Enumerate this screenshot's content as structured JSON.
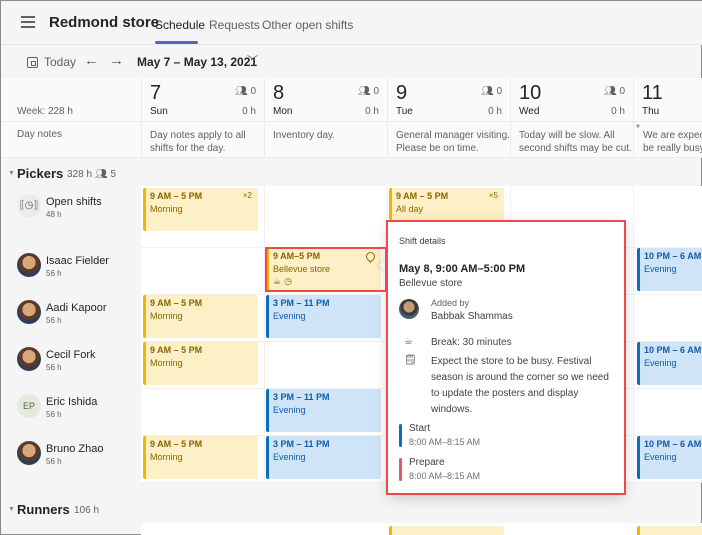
{
  "header": {
    "store_title": "Redmond store",
    "tabs": [
      {
        "label": "Schedule",
        "active": true
      },
      {
        "label": "Requests",
        "active": false
      },
      {
        "label": "Other open shifts",
        "active": false
      }
    ],
    "accent_color": "#5b5fc7"
  },
  "toolbar": {
    "today_label": "Today",
    "prev_icon": "arrow-left-icon",
    "next_icon": "arrow-right-icon",
    "date_range": "May 7 – May 13, 2021"
  },
  "grid": {
    "week_label": "Week: 228 h",
    "day_notes_label": "Day notes",
    "days": [
      {
        "num": "7",
        "name": "Sun",
        "people": "0",
        "hours": "0 h",
        "note1": "Day notes apply to all",
        "note2": "shifts for the day."
      },
      {
        "num": "8",
        "name": "Mon",
        "people": "0",
        "hours": "0 h",
        "note1": "Inventory day.",
        "note2": ""
      },
      {
        "num": "9",
        "name": "Tue",
        "people": "0",
        "hours": "0 h",
        "note1": "General manager visiting.",
        "note2": "Please be on time."
      },
      {
        "num": "10",
        "name": "Wed",
        "people": "0",
        "hours": "0 h",
        "note1": "Today will be slow. All",
        "note2": "second shifts may be cut."
      },
      {
        "num": "11",
        "name": "Thu",
        "people": "",
        "hours": "",
        "note1": "We are expecting",
        "note2": "be really busy."
      }
    ]
  },
  "groups": [
    {
      "name": "Pickers",
      "hours": "328 h",
      "members": "5"
    },
    {
      "name": "Runners",
      "hours": "106 h"
    }
  ],
  "members": [
    {
      "name": "Open shifts",
      "hours": "48 h",
      "avatar": "open-shifts-icon"
    },
    {
      "name": "Isaac Fielder",
      "hours": "56 h",
      "avatar": "photo"
    },
    {
      "name": "Aadi Kapoor",
      "hours": "56 h",
      "avatar": "photo"
    },
    {
      "name": "Cecil Fork",
      "hours": "56 h",
      "avatar": "photo"
    },
    {
      "name": "Eric Ishida",
      "hours": "56 h",
      "avatar": "EP"
    },
    {
      "name": "Bruno Zhao",
      "hours": "56 h",
      "avatar": "photo"
    }
  ],
  "shifts": {
    "open_sun": {
      "time": "9 AM – 5 PM",
      "label": "Morning",
      "count": "×2"
    },
    "open_tue": {
      "time": "9 AM – 5 PM",
      "label": "All day",
      "count": "×5"
    },
    "isaac_mon": {
      "time": "9 AM–5 PM",
      "label": "Bellevue store"
    },
    "isaac_thu": {
      "time": "10 PM – 6 AM",
      "label": "Evening"
    },
    "aadi_sun": {
      "time": "9 AM – 5 PM",
      "label": "Morning"
    },
    "aadi_mon": {
      "time": "3 PM – 11 PM",
      "label": "Evening"
    },
    "cecil_sun": {
      "time": "9 AM – 5 PM",
      "label": "Morning"
    },
    "cecil_thu": {
      "time": "10 PM – 6 AM",
      "label": "Evening"
    },
    "eric_mon": {
      "time": "3 PM – 11 PM",
      "label": "Evening"
    },
    "bruno_sun": {
      "time": "9 AM – 5 PM",
      "label": "Morning"
    },
    "bruno_mon": {
      "time": "3 PM – 11 PM",
      "label": "Evening"
    },
    "bruno_thu": {
      "time": "10 PM – 6 AM",
      "label": "Evening"
    }
  },
  "popup": {
    "title": "Shift details",
    "date": "May 8, 9:00 AM–5:00 PM",
    "location": "Bellevue store",
    "added_by_label": "Added by",
    "added_by_name": "Babbak Shammas",
    "break": "Break: 30 minutes",
    "note": "Expect the store to be busy. Festival season is around the corner so we need to update the posters and display windows.",
    "activities": [
      {
        "name": "Start",
        "time": "8:00 AM–8:15 AM",
        "color": "#0f6cbd"
      },
      {
        "name": "Prepare",
        "time": "8:00 AM–8:15 AM",
        "color": "#e8566a"
      }
    ]
  }
}
